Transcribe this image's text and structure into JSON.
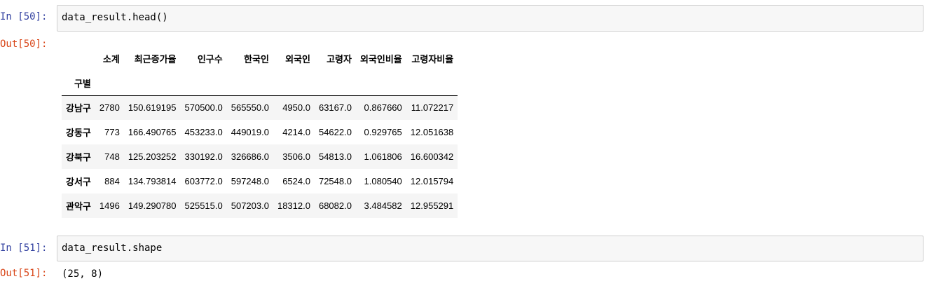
{
  "cells": [
    {
      "in_prompt": "In [50]:",
      "code": "data_result.head()",
      "out_prompt": "Out[50]:",
      "table": {
        "index_name": "구별",
        "columns": [
          "소계",
          "최근증가율",
          "인구수",
          "한국인",
          "외국인",
          "고령자",
          "외국인비율",
          "고령자비율"
        ],
        "rows": [
          {
            "index": "강남구",
            "values": [
              "2780",
              "150.619195",
              "570500.0",
              "565550.0",
              "4950.0",
              "63167.0",
              "0.867660",
              "11.072217"
            ]
          },
          {
            "index": "강동구",
            "values": [
              "773",
              "166.490765",
              "453233.0",
              "449019.0",
              "4214.0",
              "54622.0",
              "0.929765",
              "12.051638"
            ]
          },
          {
            "index": "강북구",
            "values": [
              "748",
              "125.203252",
              "330192.0",
              "326686.0",
              "3506.0",
              "54813.0",
              "1.061806",
              "16.600342"
            ]
          },
          {
            "index": "강서구",
            "values": [
              "884",
              "134.793814",
              "603772.0",
              "597248.0",
              "6524.0",
              "72548.0",
              "1.080540",
              "12.015794"
            ]
          },
          {
            "index": "관악구",
            "values": [
              "1496",
              "149.290780",
              "525515.0",
              "507203.0",
              "18312.0",
              "68082.0",
              "3.484582",
              "12.955291"
            ]
          }
        ]
      }
    },
    {
      "in_prompt": "In [51]:",
      "code": "data_result.shape",
      "out_prompt": "Out[51]:",
      "output_text": "(25, 8)"
    }
  ]
}
